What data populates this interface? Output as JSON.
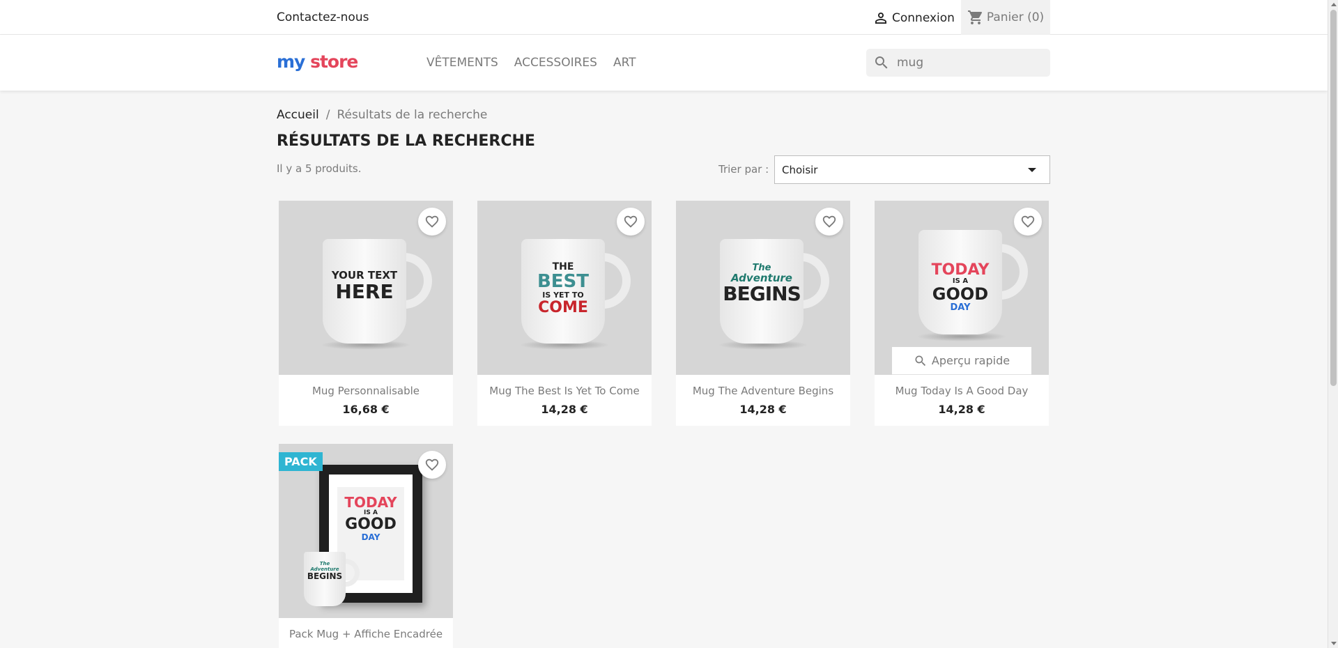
{
  "topbar": {
    "contact_label": "Contactez-nous",
    "login_label": "Connexion",
    "cart_label": "Panier (0)"
  },
  "header": {
    "logo_my": "my",
    "logo_store": "store",
    "nav": [
      {
        "label": "VÊTEMENTS"
      },
      {
        "label": "ACCESSOIRES"
      },
      {
        "label": "ART"
      }
    ],
    "search_value": "mug"
  },
  "breadcrumb": {
    "home": "Accueil",
    "separator": "/",
    "current": "Résultats de la recherche"
  },
  "page_title": "RÉSULTATS DE LA RECHERCHE",
  "product_count": "Il y a 5 produits.",
  "sort": {
    "label": "Trier par :",
    "selected": "Choisir"
  },
  "quick_view_label": "Aperçu rapide",
  "products": [
    {
      "name": "Mug Personnalisable",
      "price": "16,68 €",
      "mug_text_1": "YOUR TEXT",
      "mug_text_2": "HERE"
    },
    {
      "name": "Mug The Best Is Yet To Come",
      "price": "14,28 €",
      "mug_text_1": "THE",
      "mug_text_2": "BEST",
      "mug_text_3": "IS YET TO",
      "mug_text_4": "COME"
    },
    {
      "name": "Mug The Adventure Begins",
      "price": "14,28 €",
      "mug_text_1": "The",
      "mug_text_2": "Adventure",
      "mug_text_3": "BEGINS"
    },
    {
      "name": "Mug Today Is A Good Day",
      "price": "14,28 €",
      "mug_text_1": "TODAY",
      "mug_text_2": "IS A",
      "mug_text_3": "GOOD",
      "mug_text_4": "DAY"
    },
    {
      "name": "Pack Mug + Affiche Encadrée",
      "badge": "PACK",
      "poster_1": "TODAY",
      "poster_2": "IS A",
      "poster_3": "GOOD",
      "poster_4": "DAY",
      "mini_1": "The",
      "mini_2": "Adventure",
      "mini_3": "BEGINS"
    }
  ],
  "colors": {
    "accent": "#2fb5d2",
    "text": "#232323",
    "muted": "#7a7a7a",
    "background": "#f6f6f6"
  },
  "icons": [
    "person-icon",
    "cart-icon",
    "search-icon",
    "heart-outline-icon"
  ]
}
